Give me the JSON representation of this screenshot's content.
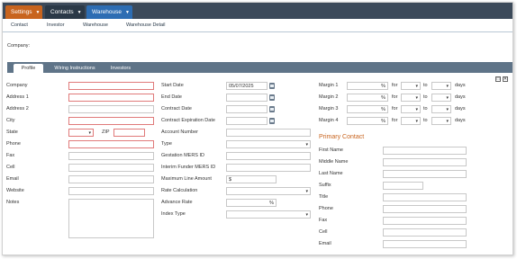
{
  "topnav": {
    "settings": "Settings",
    "contacts": "Contacts",
    "warehouse": "Warehouse"
  },
  "subnav": [
    "Contact",
    "Investor",
    "Warehouse",
    "Warehouse Detail"
  ],
  "company_label": "Company:",
  "tabs": [
    "Profile",
    "Wiring Instructions",
    "Investors"
  ],
  "col1": {
    "company": "Company",
    "address1": "Address 1",
    "address2": "Address 2",
    "city": "City",
    "state": "State",
    "zip": "ZIP",
    "phone": "Phone",
    "fax": "Fax",
    "cell": "Cell",
    "email": "Email",
    "website": "Website",
    "notes": "Notes"
  },
  "col2": {
    "start_date": "Start Date",
    "start_date_value": "05/07/2025",
    "end_date": "End Date",
    "contract_date": "Contract Date",
    "contract_expiration_date": "Contract Expiration Date",
    "account_number": "Account Number",
    "type": "Type",
    "gestation_mers_id": "Gestation MERS ID",
    "interim_funder_mers_id": "Interim Funder MERS ID",
    "maximum_line_amount": "Maximum Line Amount",
    "maximum_line_prefix": "$",
    "rate_calculation": "Rate Calculation",
    "advance_rate": "Advance Rate",
    "advance_rate_suffix": "%",
    "index_type": "Index Type"
  },
  "col3": {
    "margins": [
      {
        "label": "Margin 1"
      },
      {
        "label": "Margin 2"
      },
      {
        "label": "Margin 3"
      },
      {
        "label": "Margin 4"
      }
    ],
    "percent": "%",
    "for_label": "for",
    "to_label": "to",
    "days_label": "days",
    "primary_contact": "Primary Contact",
    "first_name": "First Name",
    "middle_name": "Middle Name",
    "last_name": "Last Name",
    "suffix": "Suffix",
    "title": "Title",
    "phone": "Phone",
    "fax": "Fax",
    "cell": "Cell",
    "email": "Email"
  },
  "colors": {
    "nav_bg": "#3c4a5a",
    "settings_tab": "#c8641e",
    "warehouse_tab": "#2d6db3",
    "tabbar": "#5f7488",
    "required_border": "#e07a7a",
    "section_title": "#c8641e"
  },
  "icons": {
    "dropdown": "▾",
    "restore": "restore-icon",
    "close": "close-icon",
    "calendar": "calendar-icon"
  }
}
